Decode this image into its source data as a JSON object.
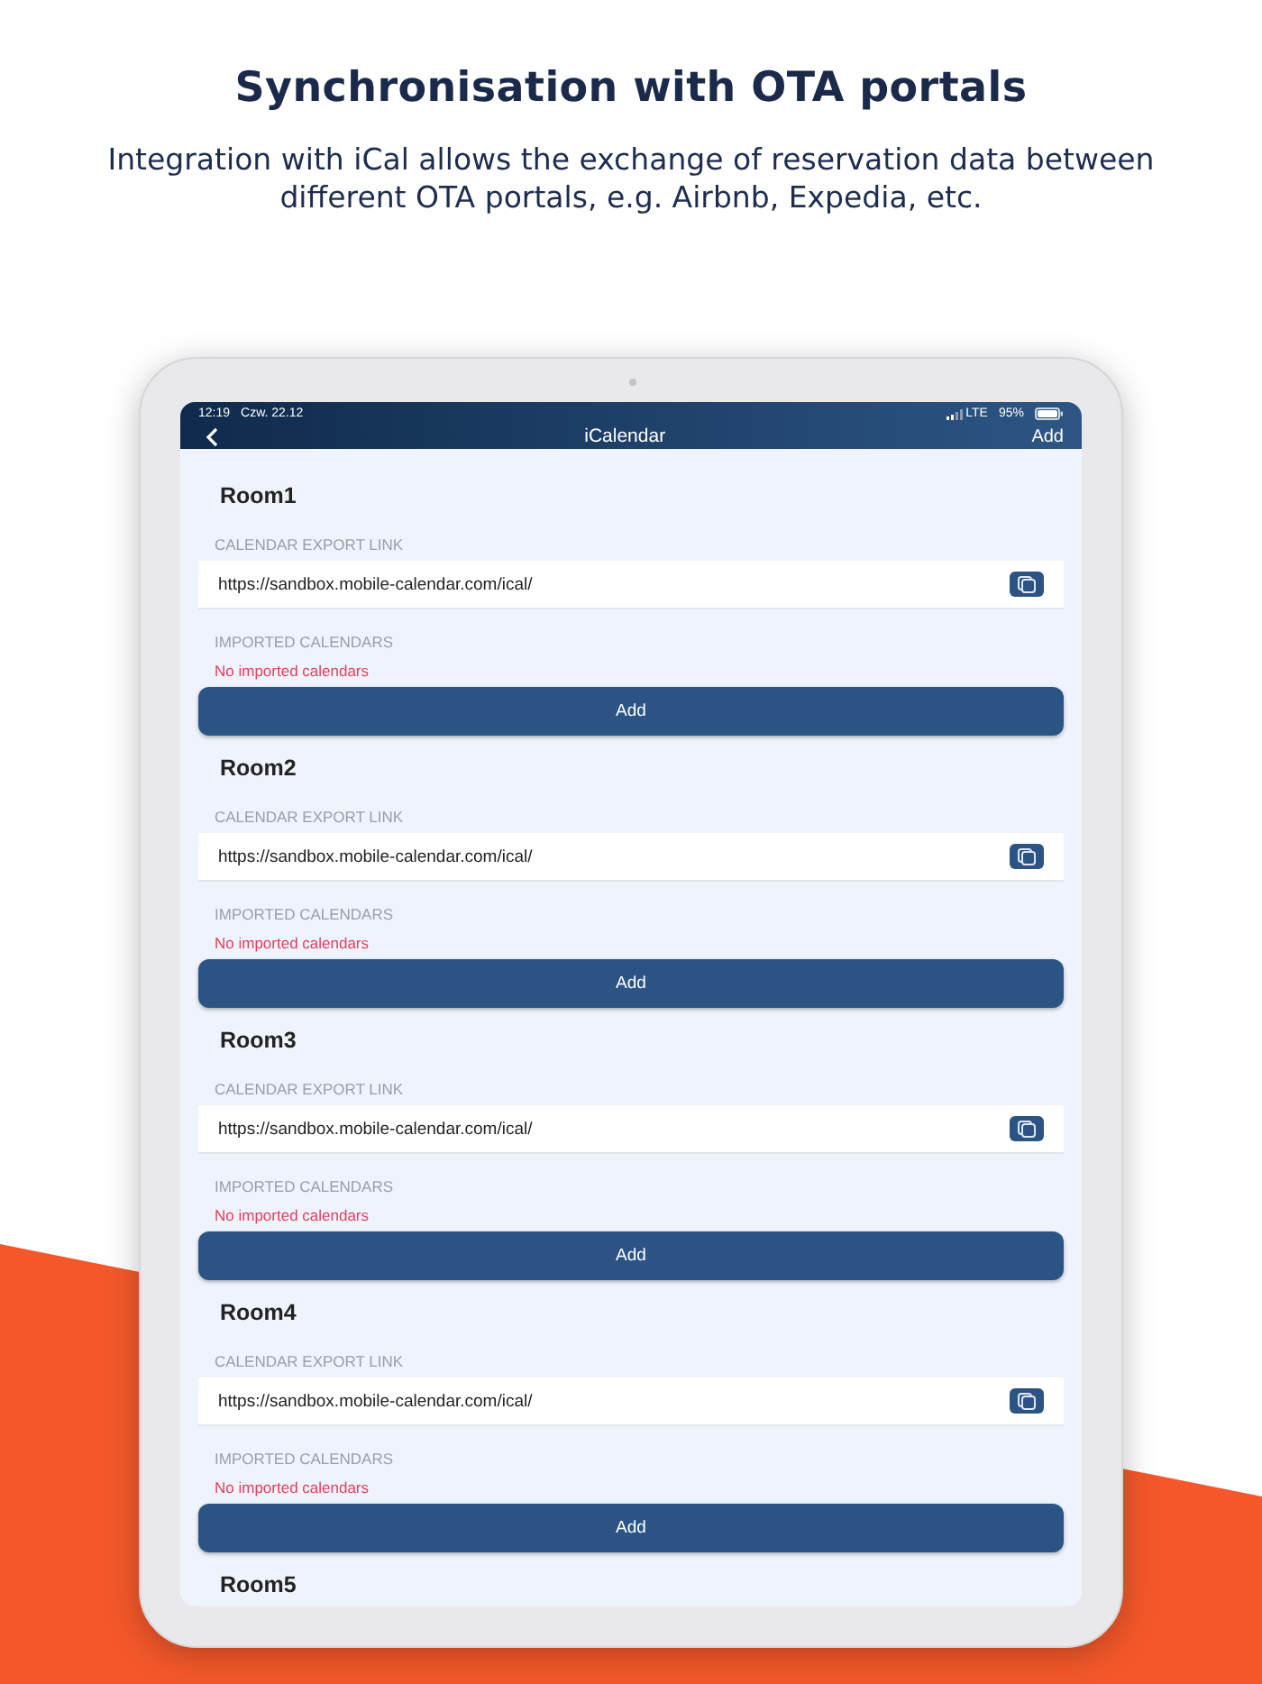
{
  "headline": "Synchronisation with OTA portals",
  "subheading": "Integration with iCal allows the exchange of reservation data between different OTA portals, e.g. Airbnb, Expedia, etc.",
  "status_bar": {
    "time": "12:19",
    "date": "Czw. 22.12",
    "network": "LTE",
    "battery": "95%"
  },
  "nav_bar": {
    "title": "iCalendar",
    "action": "Add"
  },
  "rooms": [
    {
      "name": "Room1",
      "export_label": "CALENDAR EXPORT LINK",
      "export_link": "https://sandbox.mobile-calendar.com/ical/",
      "imported_label": "IMPORTED CALENDARS",
      "imported_empty": "No imported calendars",
      "button": "Add"
    },
    {
      "name": "Room2",
      "export_label": "CALENDAR EXPORT LINK",
      "export_link": "https://sandbox.mobile-calendar.com/ical/",
      "imported_label": "IMPORTED CALENDARS",
      "imported_empty": "No imported calendars",
      "button": "Add"
    },
    {
      "name": "Room3",
      "export_label": "CALENDAR EXPORT LINK",
      "export_link": "https://sandbox.mobile-calendar.com/ical/",
      "imported_label": "IMPORTED CALENDARS",
      "imported_empty": "No imported calendars",
      "button": "Add"
    },
    {
      "name": "Room4",
      "export_label": "CALENDAR EXPORT LINK",
      "export_link": "https://sandbox.mobile-calendar.com/ical/",
      "imported_label": "IMPORTED CALENDARS",
      "imported_empty": "No imported calendars",
      "button": "Add"
    },
    {
      "name": "Room5"
    }
  ]
}
